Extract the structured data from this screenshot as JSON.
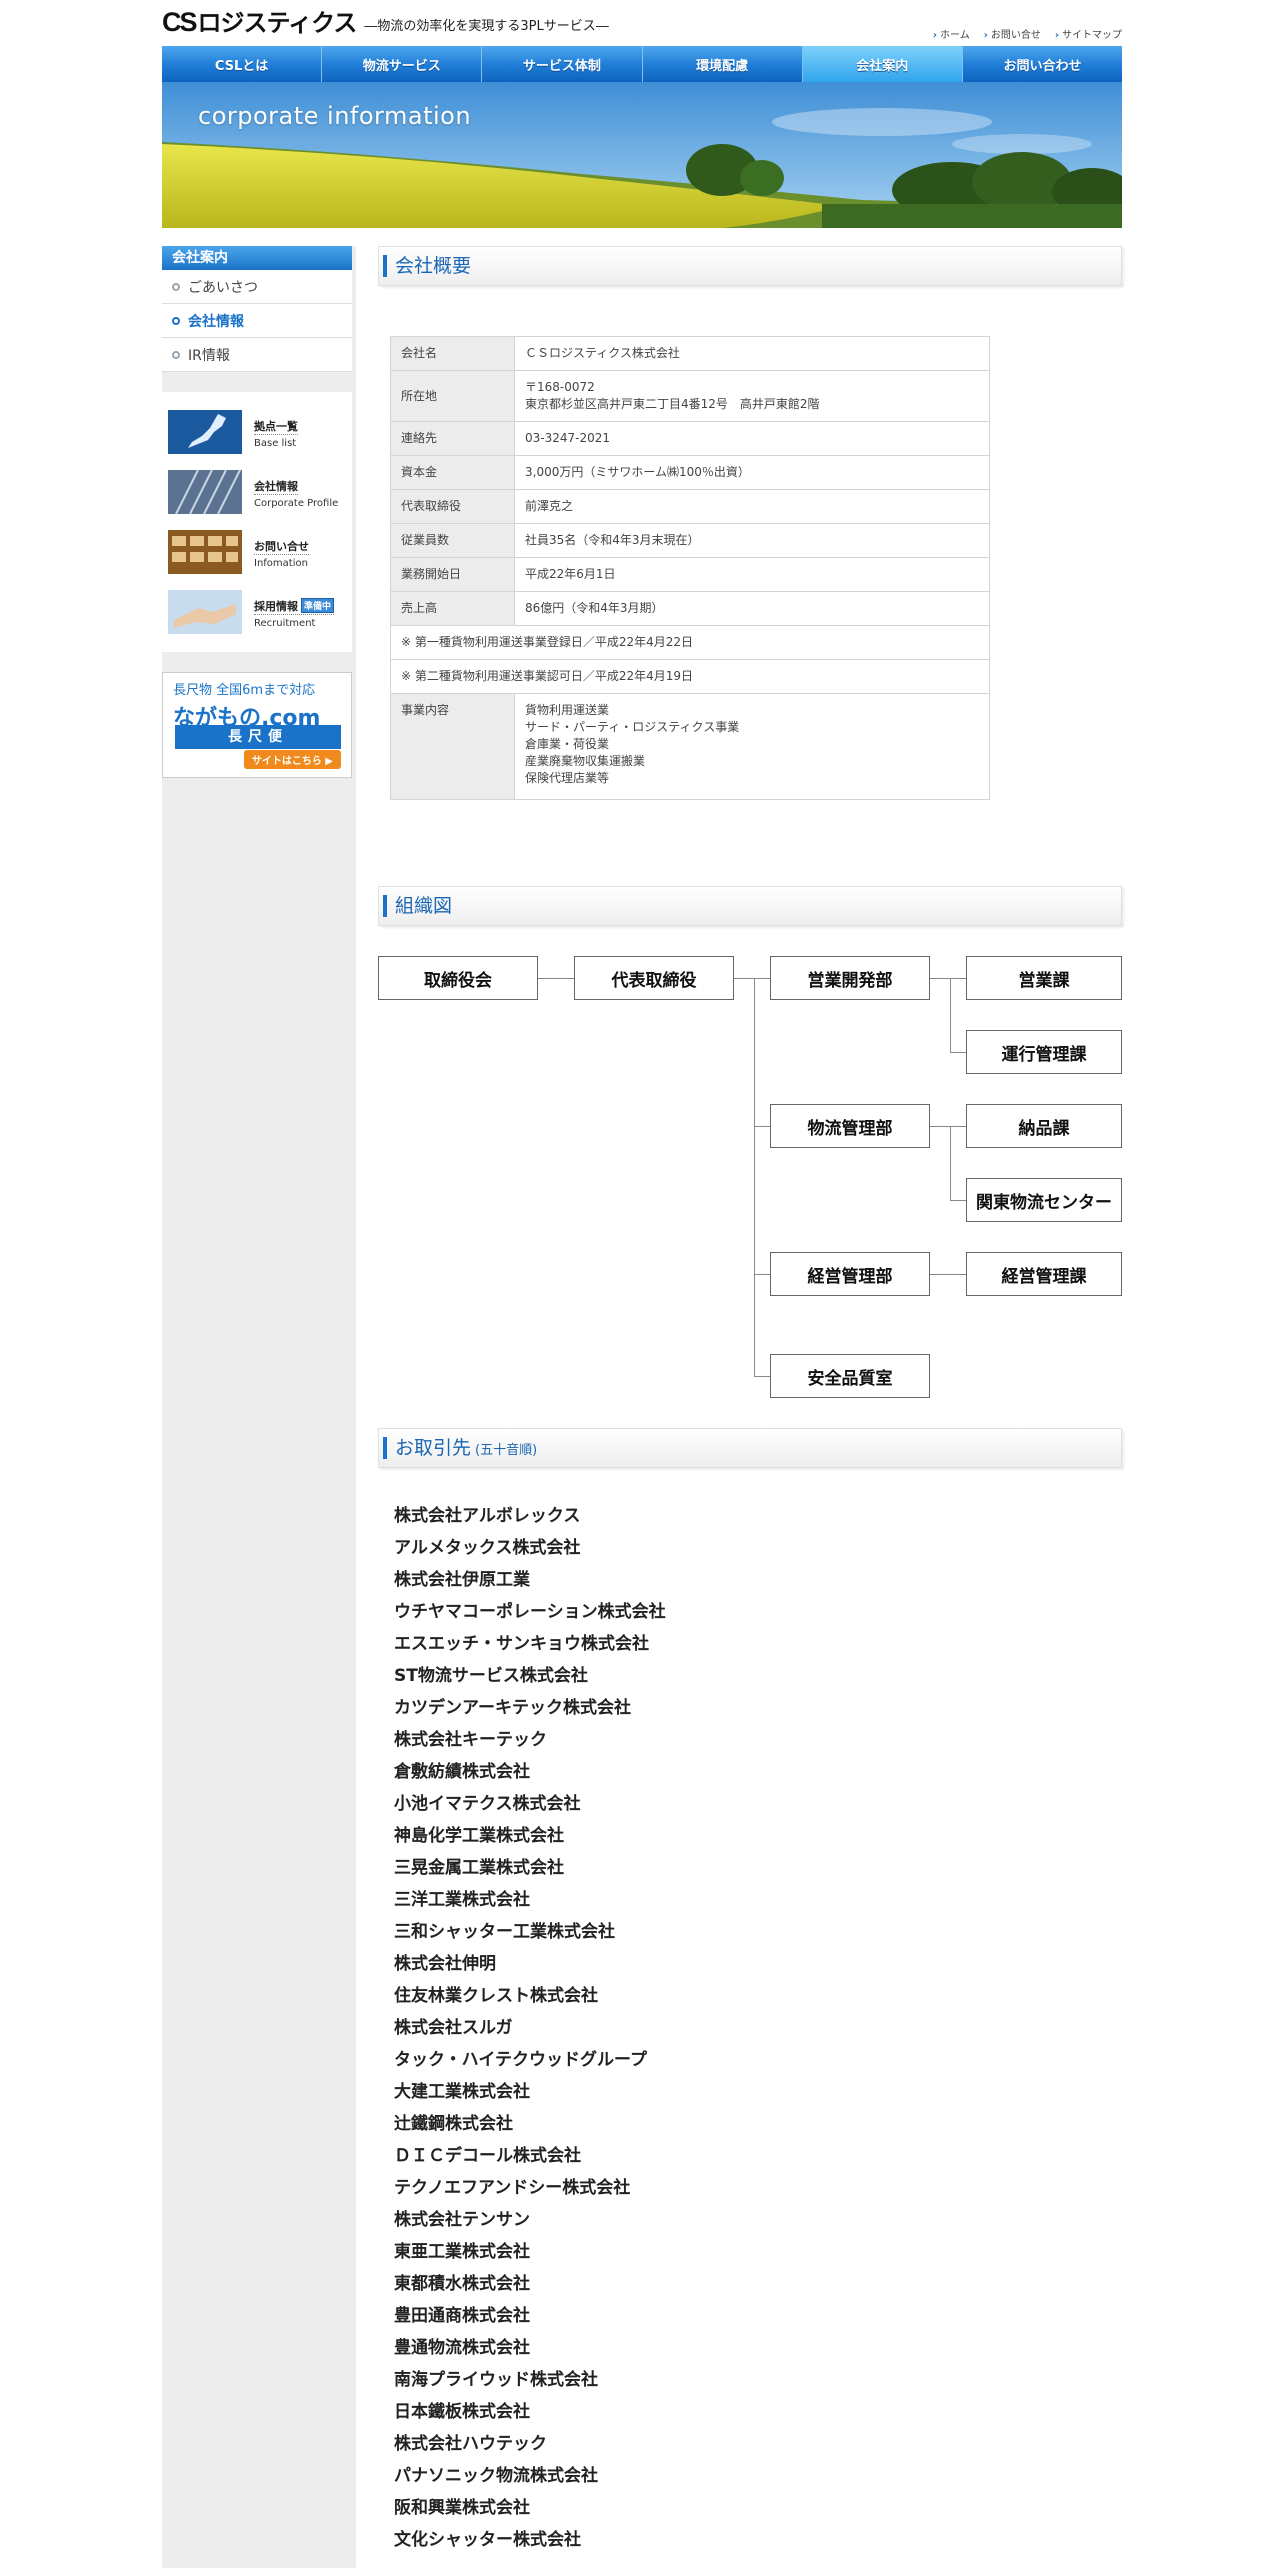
{
  "header": {
    "logo_mark": "CS",
    "logo_text": "ロジスティクス",
    "tagline": "―物流の効率化を実現する3PLサービス―",
    "utility": [
      "ホーム",
      "お問い合せ",
      "サイトマップ"
    ]
  },
  "nav": [
    "CSLとは",
    "物流サービス",
    "サービス体制",
    "環境配慮",
    "会社案内",
    "お問い合わせ"
  ],
  "nav_active_index": 4,
  "hero": {
    "title": "corporate information"
  },
  "sidebar": {
    "heading": "会社案内",
    "links": [
      "ごあいさつ",
      "会社情報",
      "IR情報"
    ],
    "active_index": 1,
    "banners": [
      {
        "title": "拠点一覧",
        "sub": "Base list"
      },
      {
        "title": "会社情報",
        "sub": "Corporate Profile"
      },
      {
        "title": "お問い合せ",
        "sub": "Infomation"
      },
      {
        "title": "採用情報",
        "sub": "Recruitment",
        "badge": "準備中"
      }
    ],
    "naga": {
      "line1": "長尺物 全国6mまで対応",
      "logo": "ながもの.com",
      "truck": "長尺便",
      "button": "サイトはこちら ▶"
    }
  },
  "profile": {
    "heading": "会社概要",
    "rows": [
      {
        "label": "会社名",
        "value": "ＣＳロジスティクス株式会社"
      },
      {
        "label": "所在地",
        "value": "〒168-0072",
        "value2": "東京都杉並区高井戸東二丁目4番12号　高井戸東館2階"
      },
      {
        "label": "連絡先",
        "value": "03-3247-2021"
      },
      {
        "label": "資本金",
        "value": "3,000万円（ミサワホーム㈱100％出資）"
      },
      {
        "label": "代表取締役",
        "value": "前澤克之"
      },
      {
        "label": "従業員数",
        "value": "社員35名（令和4年3月末現在）"
      },
      {
        "label": "業務開始日",
        "value": "平成22年6月1日"
      },
      {
        "label": "売上高",
        "value": "86億円（令和4年3月期）"
      }
    ],
    "notes": [
      "※ 第一種貨物利用運送事業登録日／平成22年4月22日",
      "※ 第二種貨物利用運送事業認可日／平成22年4月19日"
    ],
    "business": {
      "label": "事業内容",
      "items": [
        "貨物利用運送業",
        "サード・パーティ・ロジスティクス事業",
        "倉庫業・荷役業",
        "産業廃棄物収集運搬業",
        "保険代理店業等"
      ]
    }
  },
  "org": {
    "heading": "組織図",
    "board": "取締役会",
    "ceo": "代表取締役",
    "d1": "営業開発部",
    "d1s1": "営業課",
    "d1s2": "運行管理課",
    "d2": "物流管理部",
    "d2s1": "納品課",
    "d2s2": "関東物流センター",
    "d3": "経営管理部",
    "d3s1": "経営管理課",
    "d4": "安全品質室"
  },
  "clients": {
    "heading": "お取引先",
    "heading_small": "(五十音順)",
    "list": [
      "株式会社アルボレックス",
      "アルメタックス株式会社",
      "株式会社伊原工業",
      "ウチヤマコーポレーション株式会社",
      "エスエッチ・サンキョウ株式会社",
      "ST物流サービス株式会社",
      "カツデンアーキテック株式会社",
      "株式会社キーテック",
      "倉敷紡績株式会社",
      "小池イマテクス株式会社",
      "神島化学工業株式会社",
      "三晃金属工業株式会社",
      "三洋工業株式会社",
      "三和シャッター工業株式会社",
      "株式会社伸明",
      "住友林業クレスト株式会社",
      "株式会社スルガ",
      "タック・ハイテクウッドグループ",
      "大建工業株式会社",
      "辻鐵鋼株式会社",
      "ＤＩＣデコール株式会社",
      "テクノエフアンドシー株式会社",
      "株式会社テンサン",
      "東亜工業株式会社",
      "東都積水株式会社",
      "豊田通商株式会社",
      "豊通物流株式会社",
      "南海プライウッド株式会社",
      "日本鐵板株式会社",
      "株式会社ハウテック",
      "パナソニック物流株式会社",
      "阪和興業株式会社",
      "文化シャッター株式会社"
    ]
  }
}
